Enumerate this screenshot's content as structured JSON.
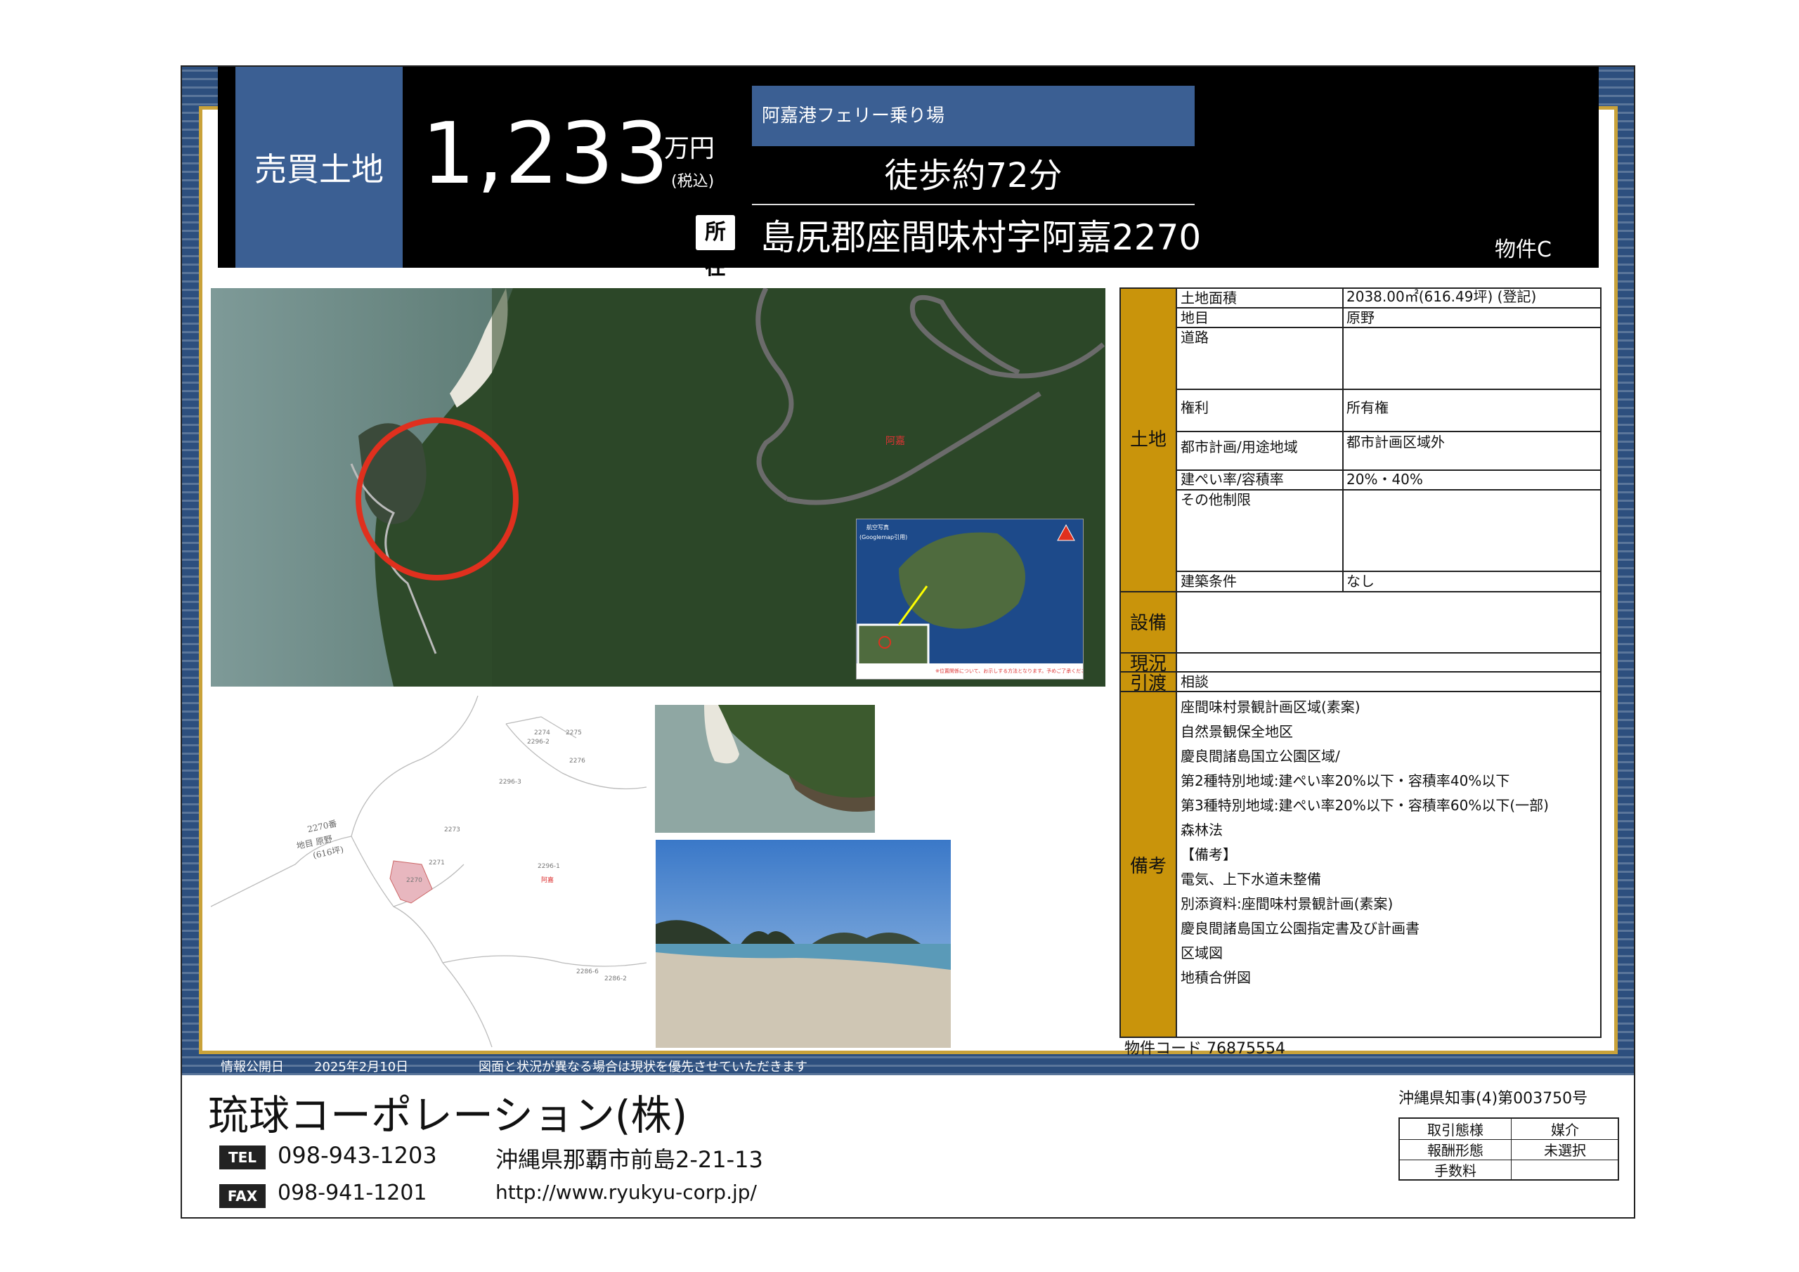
{
  "header": {
    "category": "売買土地",
    "price": "1,233",
    "price_unit": "万円",
    "tax_note": "(税込)",
    "ferry": "阿嘉港フェリー乗り場",
    "walk_time": "徒歩約72分",
    "address_icon": "所在",
    "address": "島尻郡座間味村字阿嘉2270",
    "property_id": "物件C"
  },
  "aerial": {
    "place_label": "阿嘉",
    "inset_title": "航空写真",
    "inset_sub": "(Googlemap引用)",
    "inset_note": "※位置関係について、お示しする方法となります。予めご了承ください。"
  },
  "plat": {
    "lot_numbers": [
      "2274",
      "2275",
      "2276",
      "2296-2",
      "2296-3",
      "2273",
      "2271",
      "2270",
      "2296-1",
      "2286-6",
      "2286-2"
    ],
    "note_lines": [
      "2270番",
      "地目 原野",
      "(616坪)"
    ],
    "place_label": "阿嘉"
  },
  "table": {
    "sections": {
      "land": "土地",
      "facilities": "設備",
      "status": "現況",
      "delivery": "引渡",
      "remarks": "備考"
    },
    "land_rows": [
      {
        "label": "土地面積",
        "value": "2038.00㎡(616.49坪) (登記)"
      },
      {
        "label": "地目",
        "value": "原野"
      },
      {
        "label": "道路",
        "value": ""
      },
      {
        "label": "権利",
        "value": "所有権"
      },
      {
        "label": "都市計画/用途地域",
        "value": "都市計画区域外"
      },
      {
        "label": "建ぺい率/容積率",
        "value": "20%・40%"
      },
      {
        "label": "その他制限",
        "value": ""
      },
      {
        "label": "建築条件",
        "value": "なし"
      }
    ],
    "delivery_value": "相談",
    "remarks": [
      "座間味村景観計画区域(素案)",
      "自然景観保全地区",
      "慶良間諸島国立公園区域/",
      "第2種特別地域:建ぺい率20%以下・容積率40%以下",
      "第3種特別地域:建ぺい率20%以下・容積率60%以下(一部)",
      "森林法",
      "【備考】",
      "電気、上下水道未整備",
      "別添資料:座間味村景観計画(素案)",
      "慶良間諸島国立公園指定書及び計画書",
      "区域図",
      "地積合併図"
    ],
    "property_code": "物件コード 76875554"
  },
  "footer": {
    "info_date_label": "情報公開日",
    "info_date": "2025年2月10日",
    "disclaimer": "図面と状況が異なる場合は現状を優先させていただきます",
    "company": "琉球コーポレーション(株)",
    "license": "沖縄県知事(4)第003750号",
    "tel_label": "TEL",
    "tel": "098-943-1203",
    "fax_label": "FAX",
    "fax": "098-941-1201",
    "address": "沖縄県那覇市前島2-21-13",
    "url": "http://www.ryukyu-corp.jp/",
    "deal_rows": [
      {
        "label": "取引態様",
        "value": "媒介"
      },
      {
        "label": "報酬形態",
        "value": "未選択"
      },
      {
        "label": "手数料",
        "value": ""
      }
    ]
  },
  "colors": {
    "navy": "#2d4f7e",
    "blue": "#3b5f93",
    "gold": "#c9940b",
    "frame_gold": "#c9a23a",
    "red_circle": "#e0301e"
  }
}
